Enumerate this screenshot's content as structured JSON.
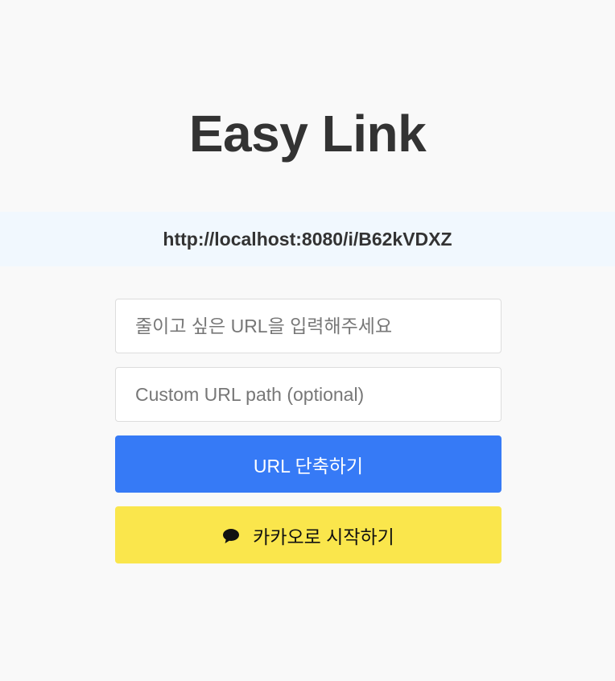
{
  "header": {
    "title": "Easy Link"
  },
  "result": {
    "short_url": "http://localhost:8080/i/B62kVDXZ"
  },
  "form": {
    "url_input": {
      "value": "",
      "placeholder": "줄이고 싶은 URL을 입력해주세요"
    },
    "custom_path_input": {
      "value": "",
      "placeholder": "Custom URL path (optional)"
    },
    "shorten_button_label": "URL 단축하기",
    "kakao_button_label": "카카오로 시작하기",
    "kakao_icon": "speech-bubble-icon"
  },
  "colors": {
    "background": "#f9f9f9",
    "banner": "#f1f8fe",
    "primary": "#367af6",
    "kakao": "#fae64c",
    "title_text": "#333333"
  }
}
